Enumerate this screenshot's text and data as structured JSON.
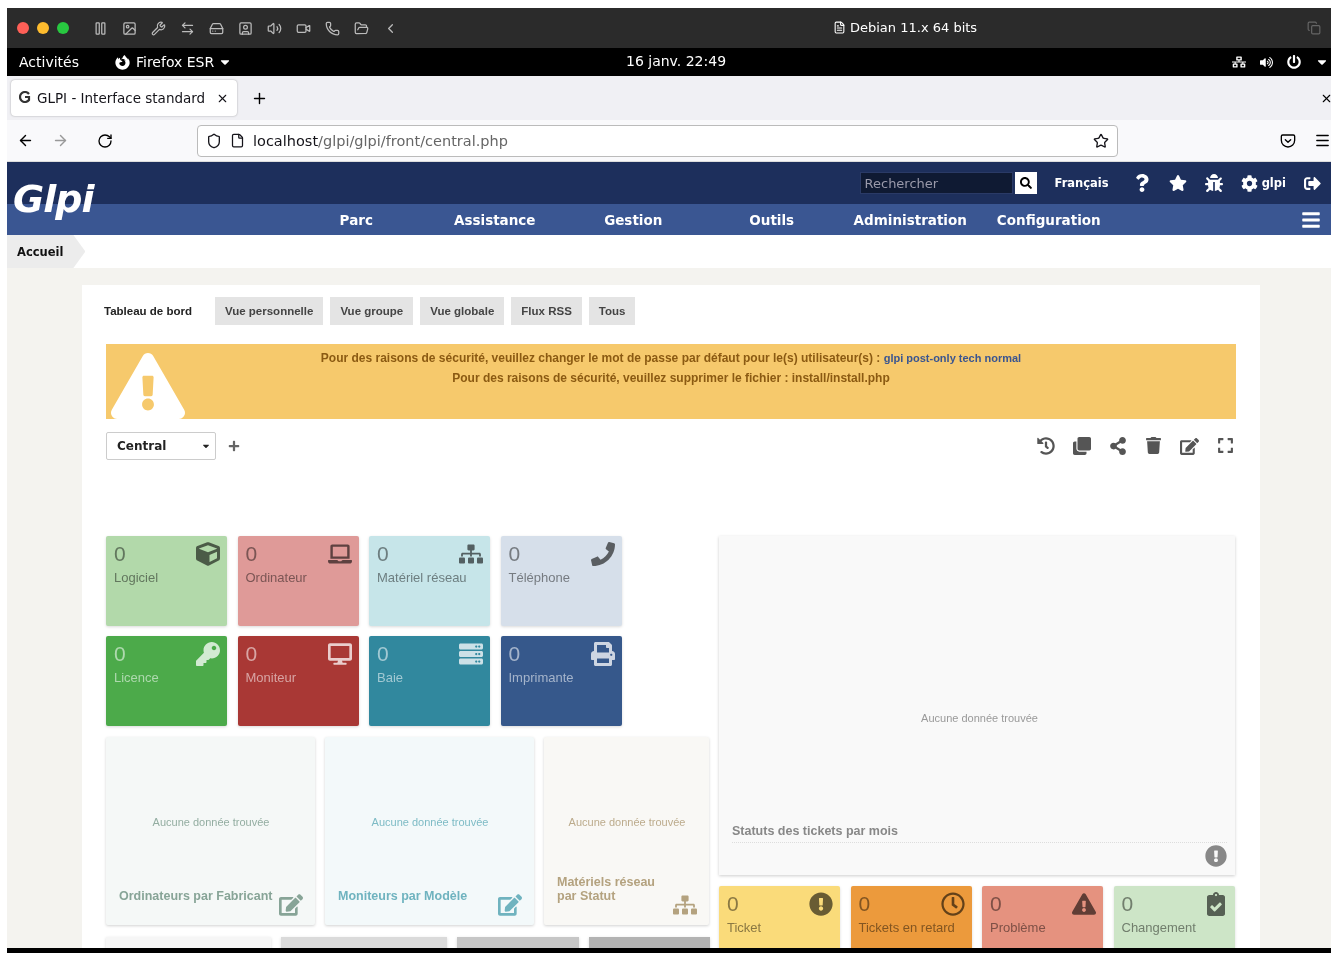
{
  "vm_toolbar": {
    "title": "Debian 11.x 64 bits"
  },
  "system_bar": {
    "activities": "Activités",
    "app": "Firefox ESR",
    "clock": "16 janv.  22:49"
  },
  "browser": {
    "tab": {
      "title": "GLPI - Interface standard",
      "selected": true
    },
    "url": {
      "host": "localhost",
      "path": "/glpi/glpi/front/central.php"
    }
  },
  "glpi_header": {
    "logo": "Glpi",
    "search": {
      "placeholder": "Rechercher"
    },
    "language": "Français",
    "user": "glpi",
    "menu": [
      "Parc",
      "Assistance",
      "Gestion",
      "Outils",
      "Administration",
      "Configuration"
    ]
  },
  "breadcrumb": [
    "Accueil"
  ],
  "tabs": [
    {
      "label": "Tableau de bord",
      "selected": true
    },
    {
      "label": "Vue personnelle",
      "selected": false
    },
    {
      "label": "Vue groupe",
      "selected": false
    },
    {
      "label": "Vue globale",
      "selected": false
    },
    {
      "label": "Flux RSS",
      "selected": false
    },
    {
      "label": "Tous",
      "selected": false
    }
  ],
  "alert": {
    "lines": [
      {
        "text": "Pour des raisons de sécurité, veuillez changer le mot de passe par défaut pour le(s) utilisateur(s) : ",
        "link": "glpi post-only tech normal"
      },
      {
        "text": "Pour des raisons de sécurité, veuillez supprimer le fichier : install/install.php"
      }
    ]
  },
  "dashboard_select": {
    "value": "Central"
  },
  "tiles": [
    {
      "count": "0",
      "label": "Logiciel",
      "kind": "software",
      "color": "#b2d9aa"
    },
    {
      "count": "0",
      "label": "Ordinateur",
      "kind": "computer",
      "color": "#df9a98"
    },
    {
      "count": "0",
      "label": "Matériel réseau",
      "kind": "network",
      "color": "#c6e5e9"
    },
    {
      "count": "0",
      "label": "Téléphone",
      "kind": "phone",
      "color": "#d6dfea"
    },
    {
      "count": "0",
      "label": "Licence",
      "kind": "license",
      "color": "#4caa4a"
    },
    {
      "count": "0",
      "label": "Moniteur",
      "kind": "monitor",
      "color": "#a93835"
    },
    {
      "count": "0",
      "label": "Baie",
      "kind": "rack",
      "color": "#31889e"
    },
    {
      "count": "0",
      "label": "Imprimante",
      "kind": "printer",
      "color": "#36588b"
    }
  ],
  "charts": [
    {
      "title": "Ordinateurs par Fabricant",
      "empty": "Aucune donnée trouvée",
      "kind": "edit",
      "color": "#87a497"
    },
    {
      "title": "Moniteurs par Modèle",
      "empty": "Aucune donnée trouvée",
      "kind": "edit",
      "color": "#6fb3bf"
    },
    {
      "title": "Matériels réseau par Statut",
      "empty": "Aucune donnée trouvée",
      "kind": "tree",
      "color": "#b4a27f"
    }
  ],
  "partial_cards": [
    {
      "color": "#f6f6f6"
    },
    {
      "color": "#dadada"
    },
    {
      "color": "#c6c6c6"
    },
    {
      "color": "#b3b3b3"
    }
  ],
  "ticket_panel": {
    "title": "Statuts des tickets par mois",
    "empty": "Aucune donnée trouvée"
  },
  "ticket_tiles": [
    {
      "count": "0",
      "label": "Ticket",
      "kind": "ticket",
      "color": "#fadb7a"
    },
    {
      "count": "0",
      "label": "Tickets en retard",
      "kind": "late",
      "color": "#ec9a3c"
    },
    {
      "count": "0",
      "label": "Problème",
      "kind": "problem",
      "color": "#e5927f"
    },
    {
      "count": "0",
      "label": "Changement",
      "kind": "change",
      "color": "#cde5c7"
    }
  ]
}
